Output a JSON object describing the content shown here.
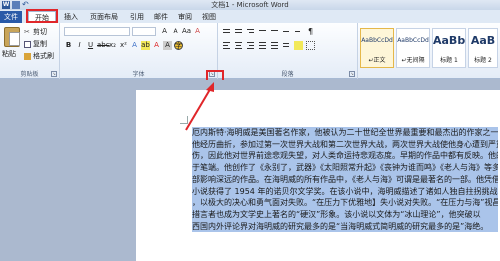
{
  "titlebar": {
    "title": "文档1 - Microsoft Word",
    "logo_letter": "W"
  },
  "tabs": [
    {
      "label": "文件"
    },
    {
      "label": "开始"
    },
    {
      "label": "插入"
    },
    {
      "label": "页面布局"
    },
    {
      "label": "引用"
    },
    {
      "label": "邮件"
    },
    {
      "label": "审阅"
    },
    {
      "label": "视图"
    }
  ],
  "clipboard": {
    "paste": "粘贴",
    "cut": "剪切",
    "copy": "复制",
    "format_painter": "格式刷",
    "group": "剪贴板"
  },
  "font": {
    "group": "字体"
  },
  "paragraph": {
    "group": "段落"
  },
  "styles": [
    {
      "sample": "AaBbCcDd",
      "name": "↵正文"
    },
    {
      "sample": "AaBbCcDd",
      "name": "↵无间隔"
    },
    {
      "sample": "AaBb",
      "name": "标题 1"
    },
    {
      "sample": "AaB",
      "name": "标题 2"
    }
  ],
  "document": {
    "lines": [
      "厄内斯特·海明威是美国著名作家，他被认为二十世纪全世界最重要和最杰出的作家之一，",
      "他经历曲折，参加过第一次世界大战和第二次世界大战，两次世界大战使他身心遭到严重的创",
      "伤，因此他对世界前途悲观失望，对人类命运持悲观态度。早期的作品中都有反映。他的作品主",
      "于笔端。他创作了《永别了，武器》《太阳照常升起》《丧钟为谁而鸣》《老人与海》等多",
      "部影响深远的作品。在海明威的所有作品中，《老人与海》可谓是最著名的一部。他凭借该",
      "小说获得了 1954 年的诺贝尔文学奖。在该小说中，海明威描述了诸如人独自拄拐挑战与斗争",
      "，以极大的决心和勇气面对失败。“在压力下优雅地】失小说对失败。“在压力与海”视昌",
      "措言者也成为文学史上著名的“硬汉”形象。该小说以文体为“冰山理论”，他突破以",
      "西国内外评论界对海明威的研究最多的是“当海明威式简明威的研究最多的是”海绝。"
    ]
  }
}
